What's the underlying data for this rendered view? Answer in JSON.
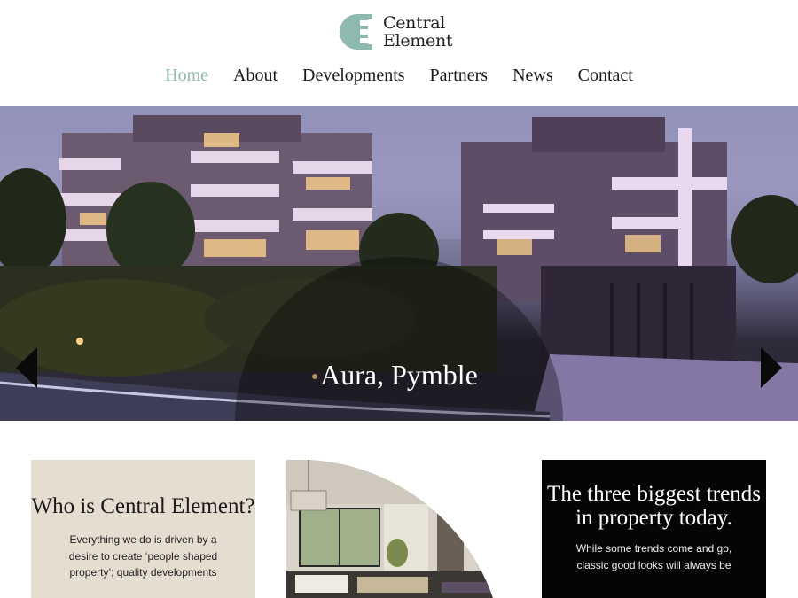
{
  "brand": {
    "line1": "Central",
    "line2": "Element",
    "accent": "#8fb8b0"
  },
  "nav": {
    "items": [
      {
        "label": "Home",
        "active": true
      },
      {
        "label": "About",
        "active": false
      },
      {
        "label": "Developments",
        "active": false
      },
      {
        "label": "Partners",
        "active": false
      },
      {
        "label": "News",
        "active": false
      },
      {
        "label": "Contact",
        "active": false
      }
    ]
  },
  "hero": {
    "caption": "Aura, Pymble",
    "prev_icon": "chevron-left-icon",
    "next_icon": "chevron-right-icon"
  },
  "cards": {
    "about": {
      "title": "Who is Central Element?",
      "body": "Everything we do is driven by a desire to create ‘people shaped property’; quality developments"
    },
    "news": {
      "title": "The three biggest trends in property today.",
      "body": "While some trends come and go, classic good looks will always be"
    }
  },
  "colors": {
    "beige": "#e6ddd1",
    "black": "#050505",
    "active_nav": "#8fb8b0"
  }
}
